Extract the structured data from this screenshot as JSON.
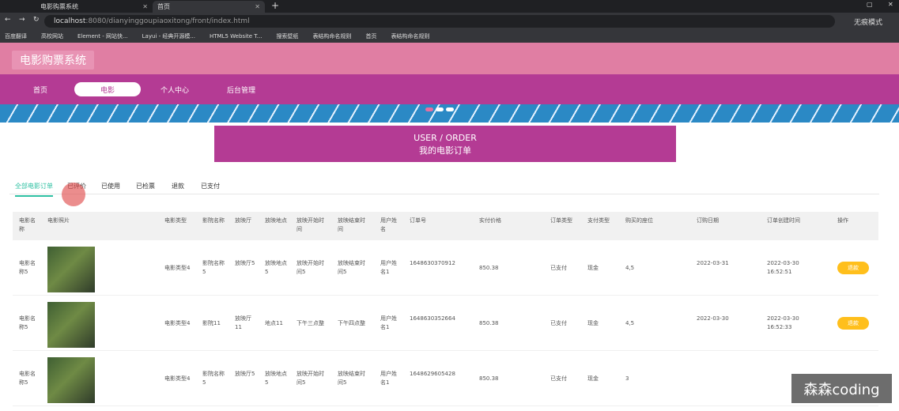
{
  "browser": {
    "tabs": [
      "电影购票系统",
      "首页"
    ],
    "url_host": "localhost",
    "url_rest": ":8080/dianyinggoupiaoxitong/front/index.html",
    "profile": "无痕模式",
    "bookmarks": [
      "百度翻译",
      "高校网站",
      "Element - 网站快...",
      "Layui - 经典开源模...",
      "HTML5 Website T...",
      "搜索壁纸",
      "表结构命名规则",
      "首页",
      "表结构命名规则"
    ]
  },
  "site": {
    "logo": "电影购票系统"
  },
  "nav": {
    "items": [
      "首页",
      "电影",
      "个人中心",
      "后台管理"
    ],
    "active": "电影"
  },
  "order_box": {
    "en": "USER / ORDER",
    "cn": "我的电影订单"
  },
  "filters": {
    "items": [
      "全部电影订单",
      "已评价",
      "已使用",
      "已检票",
      "退款",
      "已支付"
    ],
    "active": "全部电影订单"
  },
  "table": {
    "headers": [
      "电影名称",
      "电影照片",
      "电影类型",
      "影院名称",
      "放映厅",
      "放映地点",
      "放映开始时间",
      "放映结束时间",
      "用户姓名",
      "订单号",
      "实付价格",
      "订单类型",
      "支付类型",
      "购买的座位",
      "订购日期",
      "订单创建时间",
      "操作"
    ],
    "rows": [
      [
        "电影名称5",
        "",
        "电影类型4",
        "影院名称5",
        "放映厅5",
        "放映地点5",
        "放映开始时间5",
        "放映结束时间5",
        "用户姓名1",
        "1648630370912",
        "850.38",
        "已支付",
        "现金",
        "4,5",
        "2022-03-31",
        "2022-03-30 16:52:51",
        "退款"
      ],
      [
        "电影名称5",
        "",
        "电影类型4",
        "影院11",
        "放映厅11",
        "地点11",
        "下午三点整",
        "下午四点整",
        "用户姓名1",
        "1648630352664",
        "850.38",
        "已支付",
        "现金",
        "4,5",
        "2022-03-30",
        "2022-03-30 16:52:33",
        "退款"
      ],
      [
        "电影名称5",
        "",
        "电影类型4",
        "影院名称5",
        "放映厅5",
        "放映地点5",
        "放映开始时间5",
        "放映结束时间5",
        "用户姓名1",
        "1648629605428",
        "850.38",
        "已支付",
        "现金",
        "3",
        "",
        "",
        ""
      ]
    ]
  },
  "watermark": "森森coding"
}
